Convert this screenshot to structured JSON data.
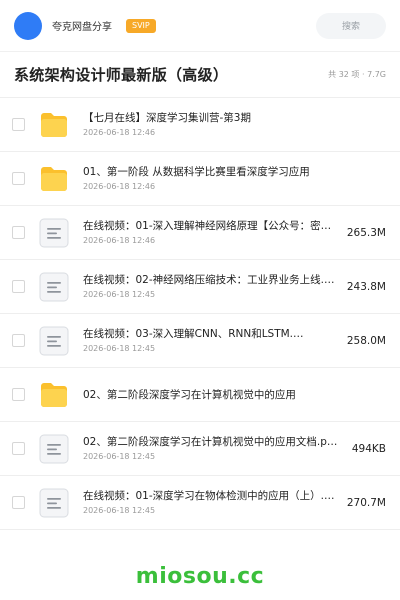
{
  "header": {
    "app_name": "夸克网盘分享",
    "badge": "SVIP",
    "search_placeholder": "搜索"
  },
  "folder": {
    "title": "系统架构设计师最新版（高级）",
    "meta": "共 32 项 · 7.7G"
  },
  "items": [
    {
      "type": "folder",
      "name": "【七月在线】深度学习集训营-第3期",
      "date": "2026-06-18 12:46",
      "size": ""
    },
    {
      "type": "folder",
      "name": "01、第一阶段 从数据科学比赛里看深度学习应用",
      "date": "2026-06-18 12:46",
      "size": ""
    },
    {
      "type": "file",
      "name": "在线视频：01-深入理解神经网络原理【公众号：密知…",
      "date": "2026-06-18 12:46",
      "size": "265.3M"
    },
    {
      "type": "file",
      "name": "在线视频：02-神经网络压缩技术：工业界业务上线.…",
      "date": "2026-06-18 12:45",
      "size": "243.8M"
    },
    {
      "type": "file",
      "name": "在线视频：03-深入理解CNN、RNN和LSTM.…",
      "date": "2026-06-18 12:45",
      "size": "258.0M"
    },
    {
      "type": "folder",
      "name": "02、第二阶段深度学习在计算机视觉中的应用",
      "date": "",
      "size": ""
    },
    {
      "type": "file",
      "name": "02、第二阶段深度学习在计算机视觉中的应用文档.p…",
      "date": "2026-06-18 12:45",
      "size": "494KB"
    },
    {
      "type": "file",
      "name": "在线视频：01-深度学习在物体检测中的应用（上）.…",
      "date": "2026-06-18 12:45",
      "size": "270.7M"
    }
  ],
  "watermark": "miosou.cc",
  "colors": {
    "accent": "#2f7cf6",
    "svip": "#f7a928",
    "folder": "#fbc02d",
    "watermark": "#3bbf3b"
  }
}
